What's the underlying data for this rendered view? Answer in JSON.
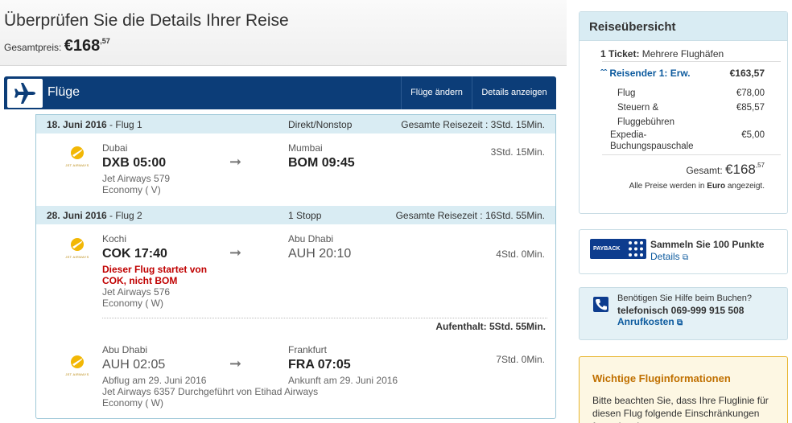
{
  "header": {
    "title": "Überprüfen Sie die Details Ihrer Reise",
    "total_label": "Gesamtpreis:",
    "total_main": "€168",
    "total_cents": ",57"
  },
  "flights": {
    "title": "Flüge",
    "change_label": "Flüge ändern",
    "details_label": "Details anzeigen",
    "segments": [
      {
        "date": "18. Juni 2016",
        "flight_label": " - Flug 1",
        "stops": "Direkt/Nonstop",
        "total_duration": "Gesamte Reisezeit : 3Std. 15Min.",
        "legs": [
          {
            "airline_caption": "JET AIRWAYS",
            "dep_city": "Dubai",
            "dep": "DXB 05:00",
            "arr_city": "Mumbai",
            "arr": "BOM 09:45",
            "flight": "Jet Airways 579",
            "cabin": "Economy ( V)",
            "duration": "3Std. 15Min."
          }
        ]
      },
      {
        "date": "28. Juni 2016",
        "flight_label": " - Flug 2",
        "stops": "1 Stopp",
        "total_duration": "Gesamte Reisezeit : 16Std. 55Min.",
        "legs": [
          {
            "airline_caption": "JET AIRWAYS",
            "dep_city": "Kochi",
            "dep": "COK 17:40",
            "warning_1": "Dieser Flug startet von",
            "warning_2": "COK, nicht BOM",
            "arr_city": "Abu Dhabi",
            "arr": "AUH 20:10",
            "flight": "Jet Airways 576",
            "cabin": "Economy ( W)",
            "duration": "4Std. 0Min."
          },
          {
            "airline_caption": "JET AIRWAYS",
            "dep_city": "Abu Dhabi",
            "dep": "AUH 02:05",
            "dep_note": "Abflug am 29. Juni 2016",
            "arr_city": "Frankfurt",
            "arr": "FRA 07:05",
            "arr_note": "Ankunft am 29. Juni 2016",
            "flight": "Jet Airways 6357 Durchgeführt von Etihad Airways",
            "cabin": "Economy ( W)",
            "duration": "7Std. 0Min."
          }
        ],
        "layover": "Aufenthalt: 5Std. 55Min."
      }
    ]
  },
  "summary": {
    "title": "Reiseübersicht",
    "ticket_bold": "1 Ticket:",
    "ticket_text": " Mehrere Flughäfen",
    "traveler": "Reisender 1: Erw.",
    "traveler_amount": "€163,57",
    "flight_label": "Flug",
    "flight_amount": "€78,00",
    "taxes_1": "Steuern &",
    "taxes_2": "Fluggebühren",
    "taxes_amount": "€85,57",
    "fee_1": "Expedia-",
    "fee_2": "Buchungspauschale",
    "fee_amount": "€5,00",
    "total_label": "Gesamt:",
    "total_main": "€168",
    "total_cents": ",57",
    "note_prefix": "Alle Preise werden in ",
    "note_bold": "Euro",
    "note_suffix": " angezeigt."
  },
  "payback": {
    "logo_text": "PAYBACK",
    "title": "Sammeln Sie 100 Punkte",
    "link": "Details"
  },
  "help": {
    "question": "Benötigen Sie Hilfe beim Buchen?",
    "phone": "telefonisch 069-999 915 508",
    "link": "Anrufkosten"
  },
  "info": {
    "title": "Wichtige Fluginformationen",
    "text": "Bitte beachten Sie, dass Ihre Fluglinie für diesen Flug folgende Einschränkungen festgelegt hat:"
  },
  "colors": {
    "brand_navy": "#0c3d78",
    "segment_header": "#d9ecf3",
    "warning_red": "#c00000",
    "info_orange": "#c07000"
  }
}
